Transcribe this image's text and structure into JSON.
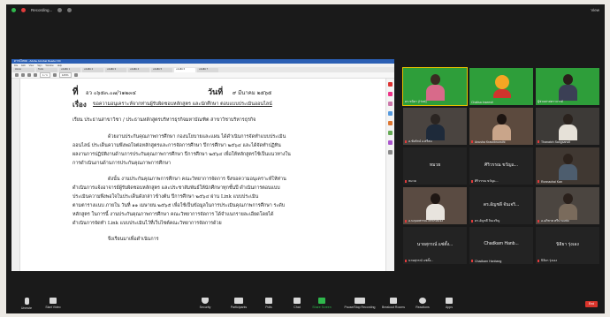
{
  "topbar": {
    "recording_label": "Recording...",
    "view_label": "View"
  },
  "pdf": {
    "window_title": "ดาวน์โหลด - Adobe Acrobat Reader DC",
    "menu": [
      "File",
      "Edit",
      "View",
      "Sign",
      "Window",
      "Help"
    ],
    "tabs": [
      "Home",
      "Tools",
      "หนังสือ 1",
      "หนังสือ 2",
      "หนังสือ 3",
      "หนังสือ 4",
      "หนังสือ 5",
      "หนังสือ 6",
      "หนังสือ 7"
    ],
    "page_indicator": "1 / 1",
    "zoom": "125%",
    "lines": {
      "at_label": "ที่",
      "at_value": "อว ๐๖๕๓.๐๗/ว๑๒๓๔",
      "date_label": "วันที่",
      "date_value": "๙ มีนาคม ๒๕๖๕",
      "subject_label": "เรื่อง",
      "subject_value": "ขอความอนุเคราะห์จากท่านผู้รับผิดชอบหลักสูตร และนักศึกษา ตอบแบบประเมินออนไลน์",
      "to": "เรียน    ประธานสาขาวิชา / ประธานหลักสูตรบริหารธุรกิจมหาบัณฑิต สาขาวิชาบริหารธุรกิจ",
      "p1_1": "ด้วยงานประกันคุณภาพการศึกษา กองนโยบายและแผน ได้ดำเนินการจัดทำแบบประเมิน",
      "p1_2": "ออนไลน์ ประเด็นความพึงพอใจต่อหลักสูตรและการจัดการศึกษา ปีการศึกษา ๒๕๖๔ และได้จัดทำปฏิทิน",
      "p1_3": "ผลงานการปฏิบัติงานด้านการประกันคุณภาพการศึกษา ปีการศึกษา ๒๕๖๔ เพื่อให้หลักสูตรใช้เป็นแนวทางใน",
      "p1_4": "การดำเนินงานด้านการประกันคุณภาพการศึกษา",
      "p2_1": "ดังนั้น งานประกันคุณภาพการศึกษา คณะวิทยาการจัดการ จึงขอความอนุเคราะห์ให้ท่าน",
      "p2_2": "ดำเนินการแจ้งอาจารย์ผู้รับผิดชอบหลักสูตร และประชาสัมพันธ์ให้นักศึกษาทุกชั้นปี ดำเนินการตอบแบบ",
      "p2_3": "ประเมินความพึงพอใจในประเด็นดังกล่าวข้างต้น ปีการศึกษา ๒๕๖๔ ผ่าน Link แบบประเมิน",
      "p2_4": "ตามตารางแนบ ภายใน วันที่ ๑๑ เมษายน ๒๕๖๕ เพื่อใช้เป็นข้อมูลในการประเมินคุณภาพการศึกษา ระดับ",
      "p2_5": "หลักสูตร ในการนี้ งานประกันคุณภาพการศึกษา คณะวิทยาการจัดการ ได้จำแนกรายละเอียดโดยได้",
      "p2_6": "ดำเนินการจัดทำ Link แบบประเมินไว้ที่เว็บไซต์คณะวิทยาการจัดการด้วย",
      "closing": "จึงเรียนมาเพื่อดำเนินการ"
    }
  },
  "participants": [
    {
      "name": "ดร.ชนิดา (Host)",
      "center": "",
      "style": "green-person"
    },
    {
      "name": "Chalisa Inseesti",
      "center": "",
      "style": "green-logo"
    },
    {
      "name": "ผู้ช่วยศาสตราจารย์",
      "center": "",
      "style": "green-person2"
    },
    {
      "name": "อ.ชัยรัตน์ อ.ศรีสม",
      "center": "",
      "style": "person"
    },
    {
      "name": "Anusha Krasnbrunsthi",
      "center": "",
      "style": "person-f"
    },
    {
      "name": "Thanatch Sangsarwit",
      "center": "",
      "style": "person-m"
    },
    {
      "name": "หมวย",
      "center": "หมวย",
      "style": "name"
    },
    {
      "name": "ศิริวรรณ ขวัญแ...",
      "center": "ศิริวรรณ ขวัญแ...",
      "style": "name"
    },
    {
      "name": "Ronnachai Kan",
      "center": "",
      "style": "person-m2"
    },
    {
      "name": "อ.นฤมลพรรณ ศรพรหมจัง",
      "center": "",
      "style": "person-f2"
    },
    {
      "name": "ดร.อัญชลี จินเจริญ",
      "center": "ดร.อัญชลี จันเจริ...",
      "style": "name"
    },
    {
      "name": "อ.อภิชาต ศรีนามเฟย",
      "center": "",
      "style": "person-m3"
    },
    {
      "name": "นายสุกรณ์ แซ่ตั้ง...",
      "center": "นายสุกรณ์ แซ่ตั้ง...",
      "style": "name"
    },
    {
      "name": "Chadkarn Hanbang",
      "center": "Chadkarn Hanb...",
      "style": "name"
    },
    {
      "name": "นิจิยา รุ่งเอง",
      "center": "นิจิยา รุ่งเอง",
      "style": "name"
    }
  ],
  "controls": [
    {
      "label": "Unmute",
      "icon": "microphone-muted-icon"
    },
    {
      "label": "Start Video",
      "icon": "video-off-icon"
    },
    {
      "label": "Security",
      "icon": "shield-icon"
    },
    {
      "label": "Participants",
      "icon": "participants-icon",
      "count": "33"
    },
    {
      "label": "Polls",
      "icon": "polls-icon"
    },
    {
      "label": "Chat",
      "icon": "chat-icon"
    },
    {
      "label": "Share Screen",
      "icon": "share-screen-icon"
    },
    {
      "label": "Pause/Stop Recording",
      "icon": "recording-icon"
    },
    {
      "label": "Breakout Rooms",
      "icon": "breakout-rooms-icon"
    },
    {
      "label": "Reactions",
      "icon": "reactions-icon"
    },
    {
      "label": "Apps",
      "icon": "apps-icon"
    }
  ],
  "end_label": "End",
  "colors": {
    "zoom_green": "#2fb84c",
    "end_red": "#d9342b",
    "frame_bg": "#1a1a1a",
    "acrobat_blue": "#2b5fb4"
  }
}
